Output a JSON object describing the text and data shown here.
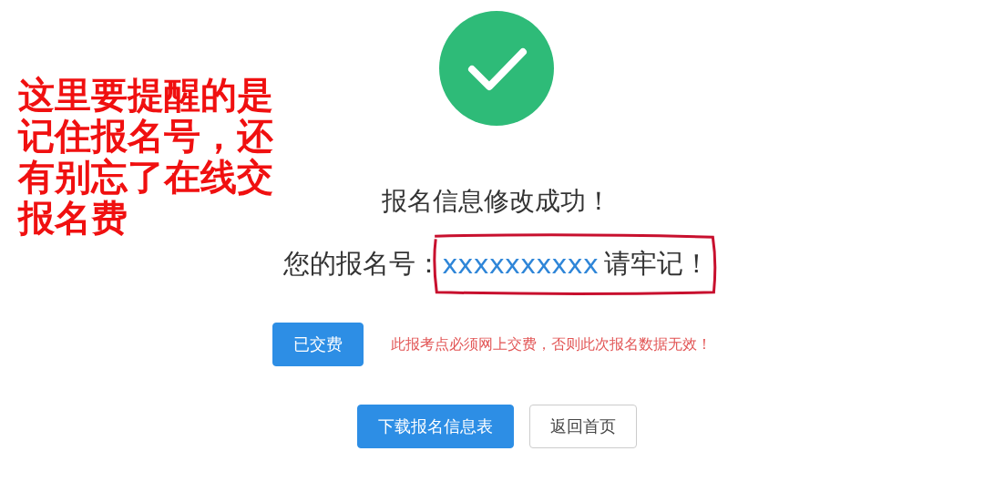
{
  "annotation": {
    "text": "这里要提醒的是记住报名号，还有别忘了在线交报名费"
  },
  "status": {
    "kind": "success",
    "title": "报名信息修改成功！"
  },
  "registration": {
    "label": "您的报名号：",
    "number": "xxxxxxxxxx",
    "reminder": "请牢记！",
    "circled": true
  },
  "payment": {
    "button": "已交费",
    "notice": "此报考点必须网上交费，否则此次报名数据无效！"
  },
  "actions": [
    {
      "label": "下载报名信息表",
      "kind": "primary"
    },
    {
      "label": "返回首页",
      "kind": "default"
    }
  ]
}
